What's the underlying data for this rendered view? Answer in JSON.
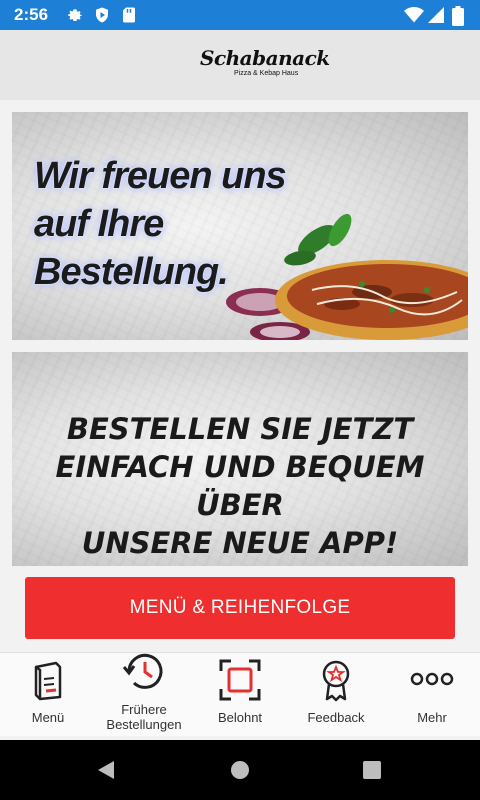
{
  "status_bar": {
    "time": "2:56",
    "left_icons": [
      "gear-icon",
      "play-protect-icon",
      "sd-card-icon"
    ],
    "right_icons": [
      "wifi-icon",
      "cell-signal-icon",
      "battery-icon"
    ],
    "color": "#1e7fd6"
  },
  "header": {
    "logo_brand": "Schabanack",
    "logo_sub": "Pizza & Kebap Haus"
  },
  "banners": [
    {
      "text": "Wir freuen uns\nauf Ihre\nBestellung."
    },
    {
      "text": "BESTELLEN SIE JETZT\nEINFACH UND BEQUEM ÜBER\nUNSERE NEUE APP!"
    }
  ],
  "cta": {
    "label": "MENÜ & REIHENFOLGE",
    "color": "#ef2f2f"
  },
  "tabs": [
    {
      "label": "Menü",
      "icon": "menu-book-icon"
    },
    {
      "label": "Frühere\nBestellungen",
      "icon": "history-icon"
    },
    {
      "label": "Belohnt",
      "icon": "reward-frame-icon"
    },
    {
      "label": "Feedback",
      "icon": "badge-star-icon"
    },
    {
      "label": "Mehr",
      "icon": "more-dots-icon"
    }
  ],
  "nav_bar": {
    "icons": [
      "back-icon",
      "home-icon",
      "recents-icon"
    ]
  }
}
